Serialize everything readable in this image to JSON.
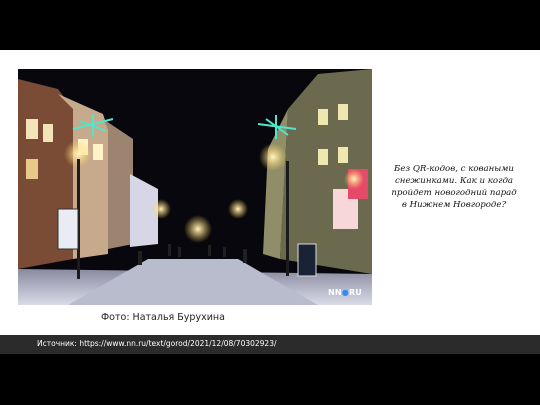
{
  "slide": {
    "photo": {
      "description_icon": "night-street-photo",
      "watermark_left": "NN",
      "watermark_dot": "●",
      "watermark_right": "RU"
    },
    "caption": "Фото: Наталья Бурухина",
    "headline": "Без QR-кодов, с коваными снежинками. Как и когда пройдет новогодний парад в Нижнем Новгороде?",
    "source": "Источник: https://www.nn.ru/text/gorod/2021/12/08/70302923/"
  },
  "colors": {
    "slide_bg": "#ffffff",
    "letterbox": "#000000",
    "source_bar": "#2b2b2b"
  }
}
